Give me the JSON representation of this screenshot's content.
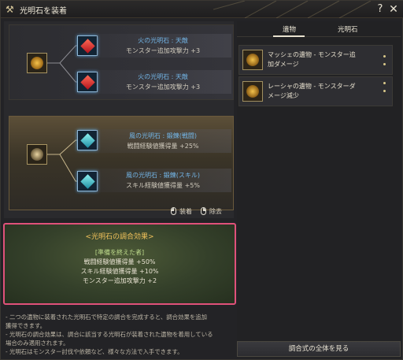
{
  "window": {
    "title": "光明石を装着",
    "help_label": "?",
    "close_label": "✕"
  },
  "groups": [
    {
      "slots": [
        {
          "name": "火の光明石 : 天敵",
          "effect": "モンスター追加攻撃力 +3"
        },
        {
          "name": "火の光明石 : 天敵",
          "effect": "モンスター追加攻撃力 +3"
        }
      ]
    },
    {
      "slots": [
        {
          "name": "風の光明石 : 鍛錬(戦闘)",
          "effect": "戦闘経験値獲得量 +25%"
        },
        {
          "name": "風の光明石 : 鍛錬(スキル)",
          "effect": "スキル経験値獲得量 +5%"
        }
      ]
    }
  ],
  "legend": {
    "equip_label": "装着",
    "remove_label": "除去"
  },
  "combination": {
    "title": "<光明石の調合効果>",
    "subtitle": "[準備を終えた者]",
    "effects": [
      "戦闘経験値獲得量 +50%",
      "スキル経験値獲得量 +10%",
      "モンスター追加攻撃力 +2"
    ]
  },
  "notes": [
    "- 二つの遺物に装着された光明石で特定の調合を完成すると、調合効果を追加",
    "  獲得できます。",
    "- 光明石の調合効果は、調合に該当する光明石が装着された遺物を着用している",
    "  場合のみ適用されます。",
    "- 光明石はモンスター討伐や依頼など、様々な方法で入手できます。"
  ],
  "tabs": [
    {
      "label": "遺物",
      "active": true
    },
    {
      "label": "光明石",
      "active": false
    }
  ],
  "relics": [
    {
      "line1": "マッシェの遺物 - モンスター追",
      "line2": "加ダメージ"
    },
    {
      "line1": "レーシャの遺物 - モンスターダ",
      "line2": "メージ減少"
    }
  ],
  "bottom_button": "調合式の全体を見る",
  "colors": {
    "highlight_border": "#e0517a",
    "stone_name": "#73b5e6",
    "combo_title": "#f0c15a"
  }
}
